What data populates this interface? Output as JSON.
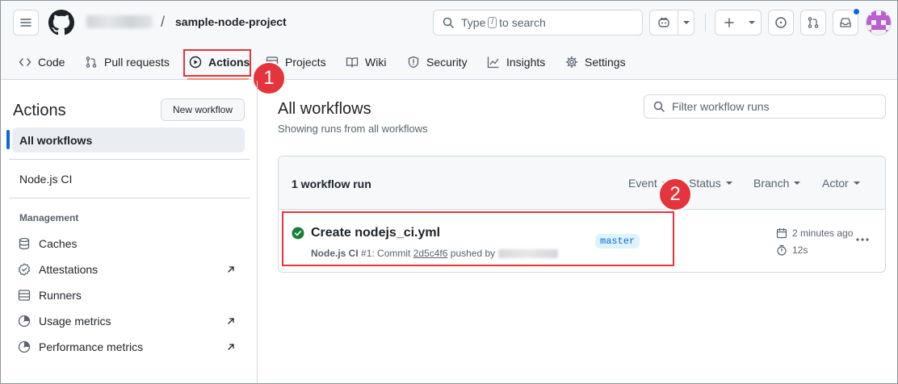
{
  "header": {
    "repo_name": "sample-node-project",
    "slash": "/",
    "search_prefix": "Type",
    "search_key": "/",
    "search_suffix": "to search"
  },
  "tabs": [
    {
      "label": "Code",
      "icon": "code-icon"
    },
    {
      "label": "Pull requests",
      "icon": "git-pull-request-icon"
    },
    {
      "label": "Actions",
      "icon": "play-icon",
      "active": true
    },
    {
      "label": "Projects",
      "icon": "table-icon"
    },
    {
      "label": "Wiki",
      "icon": "book-icon"
    },
    {
      "label": "Security",
      "icon": "shield-icon"
    },
    {
      "label": "Insights",
      "icon": "graph-icon"
    },
    {
      "label": "Settings",
      "icon": "gear-icon"
    }
  ],
  "callouts": [
    "1",
    "2"
  ],
  "sidebar": {
    "title": "Actions",
    "new_workflow": "New workflow",
    "all_workflows": "All workflows",
    "workflows": [
      "Node.js CI"
    ],
    "management_label": "Management",
    "management": [
      {
        "label": "Caches",
        "icon": "database-icon",
        "external": false
      },
      {
        "label": "Attestations",
        "icon": "verified-icon",
        "external": true
      },
      {
        "label": "Runners",
        "icon": "server-icon",
        "external": false
      },
      {
        "label": "Usage metrics",
        "icon": "meter-icon",
        "external": true
      },
      {
        "label": "Performance metrics",
        "icon": "meter-icon",
        "external": true
      }
    ]
  },
  "main": {
    "title": "All workflows",
    "subtitle": "Showing runs from all workflows",
    "filter_placeholder": "Filter workflow runs",
    "runs_count": "1 workflow run",
    "filters": [
      "Event",
      "Status",
      "Branch",
      "Actor"
    ],
    "run": {
      "title": "Create nodejs_ci.yml",
      "workflow": "Node.js CI",
      "run_number": "#1",
      "meta_mid": ": Commit",
      "sha": "2d5c4f6",
      "pushed_by": "pushed by",
      "branch": "master",
      "time_ago": "2 minutes ago",
      "duration": "12s"
    }
  },
  "colors": {
    "accent": "#0969da",
    "success": "#1a7f37",
    "callout_red": "#e5343b",
    "tab_underline": "#fd8c73"
  }
}
